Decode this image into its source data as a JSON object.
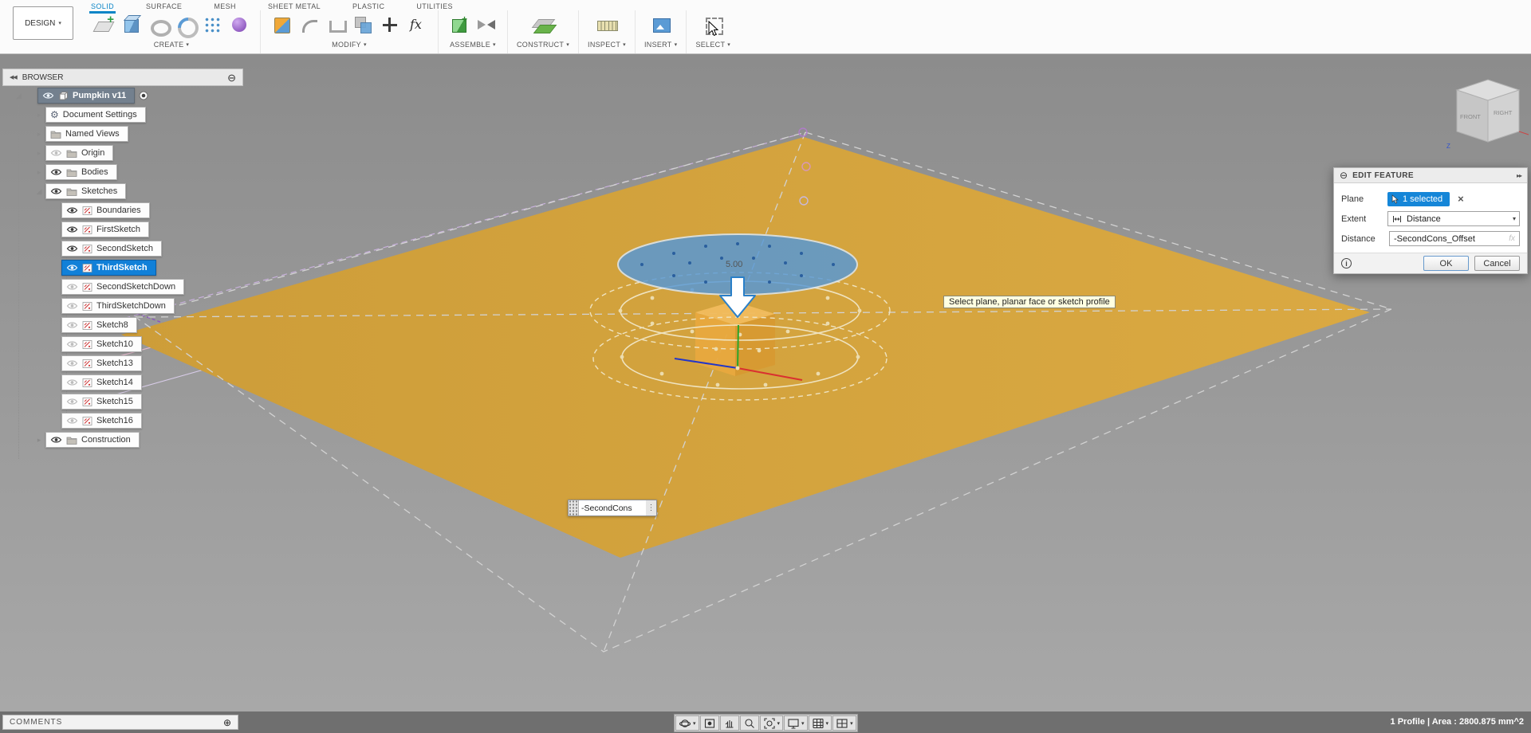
{
  "app": {
    "design_menu": "DESIGN",
    "tabs": [
      {
        "label": "SOLID",
        "active": true
      },
      {
        "label": "SURFACE",
        "active": false
      },
      {
        "label": "MESH",
        "active": false
      },
      {
        "label": "SHEET METAL",
        "active": false
      },
      {
        "label": "PLASTIC",
        "active": false
      },
      {
        "label": "UTILITIES",
        "active": false
      }
    ],
    "toolbar_groups": [
      {
        "label": "CREATE",
        "icons": [
          "create-sketch",
          "extrude",
          "revolve",
          "sweep",
          "pattern",
          "form"
        ]
      },
      {
        "label": "MODIFY",
        "icons": [
          "press-pull",
          "fillet",
          "shell",
          "combine",
          "move",
          "parameters-fx"
        ]
      },
      {
        "label": "ASSEMBLE",
        "icons": [
          "new-component",
          "joint"
        ]
      },
      {
        "label": "CONSTRUCT",
        "icons": [
          "offset-plane"
        ]
      },
      {
        "label": "INSPECT",
        "icons": [
          "measure"
        ]
      },
      {
        "label": "INSERT",
        "icons": [
          "insert-canvas"
        ]
      },
      {
        "label": "SELECT",
        "icons": [
          "select-window"
        ]
      }
    ]
  },
  "browser": {
    "title": "BROWSER",
    "items": [
      {
        "label": "Pumpkin v11",
        "level": 0,
        "icon": "component",
        "eye": "visible",
        "state": "active-root",
        "expand": "expanded",
        "radio": true
      },
      {
        "label": "Document Settings",
        "level": 1,
        "icon": "gear",
        "expand": "collapsed"
      },
      {
        "label": "Named Views",
        "level": 1,
        "icon": "folder",
        "expand": "collapsed"
      },
      {
        "label": "Origin",
        "level": 1,
        "icon": "folder",
        "eye": "hidden",
        "expand": "collapsed"
      },
      {
        "label": "Bodies",
        "level": 1,
        "icon": "folder",
        "eye": "visible",
        "expand": "collapsed"
      },
      {
        "label": "Sketches",
        "level": 1,
        "icon": "folder",
        "eye": "visible",
        "expand": "expanded"
      },
      {
        "label": "Boundaries",
        "level": 2,
        "icon": "sketch",
        "eye": "visible"
      },
      {
        "label": "FirstSketch",
        "level": 2,
        "icon": "sketch",
        "eye": "visible"
      },
      {
        "label": "SecondSketch",
        "level": 2,
        "icon": "sketch",
        "eye": "visible"
      },
      {
        "label": "ThirdSketch",
        "level": 2,
        "icon": "sketch",
        "eye": "visible",
        "state": "selected"
      },
      {
        "label": "SecondSketchDown",
        "level": 2,
        "icon": "sketch",
        "eye": "hidden"
      },
      {
        "label": "ThirdSketchDown",
        "level": 2,
        "icon": "sketch",
        "eye": "hidden"
      },
      {
        "label": "Sketch8",
        "level": 2,
        "icon": "sketch",
        "eye": "hidden"
      },
      {
        "label": "Sketch10",
        "level": 2,
        "icon": "sketch",
        "eye": "hidden"
      },
      {
        "label": "Sketch13",
        "level": 2,
        "icon": "sketch",
        "eye": "hidden"
      },
      {
        "label": "Sketch14",
        "level": 2,
        "icon": "sketch",
        "eye": "hidden"
      },
      {
        "label": "Sketch15",
        "level": 2,
        "icon": "sketch",
        "eye": "hidden"
      },
      {
        "label": "Sketch16",
        "level": 2,
        "icon": "sketch",
        "eye": "hidden"
      },
      {
        "label": "Construction",
        "level": 1,
        "icon": "folder",
        "eye": "visible",
        "expand": "collapsed"
      }
    ]
  },
  "dialog": {
    "title": "EDIT FEATURE",
    "plane_label": "Plane",
    "plane_value": "1 selected",
    "extent_label": "Extent",
    "extent_value": "Distance",
    "distance_label": "Distance",
    "distance_value": "-SecondCons_Offset",
    "fx_label": "fx",
    "ok_label": "OK",
    "cancel_label": "Cancel"
  },
  "viewport": {
    "tooltip": "Select plane, planar face or sketch profile",
    "dimension_label": "5.00",
    "offset_field_value": "-SecondCons",
    "viewcube": {
      "front": "FRONT",
      "right": "RIGHT",
      "axis_z": "Z"
    }
  },
  "bottom": {
    "comments_label": "COMMENTS",
    "status_text": "1 Profile | Area : 2800.875 mm^2",
    "nav_icons": [
      {
        "name": "orbit",
        "caret": true
      },
      {
        "name": "look-at",
        "caret": false
      },
      {
        "name": "pan",
        "caret": false
      },
      {
        "name": "zoom",
        "caret": false
      },
      {
        "name": "fit",
        "caret": true
      },
      {
        "name": "display-settings",
        "caret": true
      },
      {
        "name": "grid-settings",
        "caret": true
      },
      {
        "name": "viewports",
        "caret": true
      }
    ]
  }
}
